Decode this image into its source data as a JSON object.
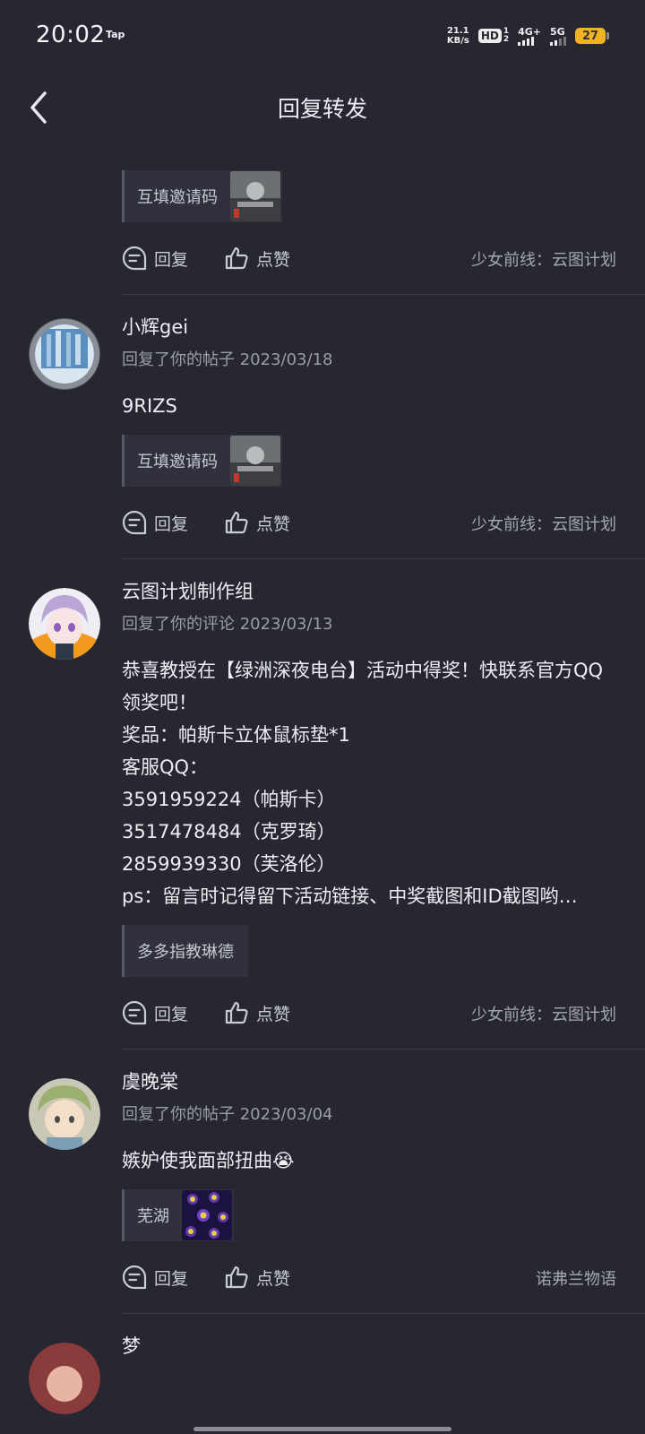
{
  "status": {
    "time": "20:02",
    "tap_label": "Tap",
    "net_speed_value": "21.1",
    "net_speed_unit": "KB/s",
    "hd_label": "HD",
    "hd_sub_top": "1",
    "hd_sub_bottom": "2",
    "net1_label": "4G+",
    "net2_label": "5G",
    "battery": "27"
  },
  "header": {
    "title": "回复转发"
  },
  "actions": {
    "reply_label": "回复",
    "like_label": "点赞"
  },
  "top_partial": {
    "quote_text": "互填邀请码",
    "source": "少女前线：云图计划"
  },
  "items": [
    {
      "name": "小辉gei",
      "meta": "回复了你的帖子 2023/03/18",
      "content": "9RIZS",
      "quote_text": "互填邀请码",
      "source": "少女前线：云图计划"
    },
    {
      "name": "云图计划制作组",
      "meta": "回复了你的评论 2023/03/13",
      "content": "恭喜教授在【绿洲深夜电台】活动中得奖！快联系官方QQ领奖吧！\n奖品：帕斯卡立体鼠标垫*1\n客服QQ：\n3591959224（帕斯卡）\n3517478484（克罗琦）\n2859939330（芙洛伦）\nps：留言时记得留下活动链接、中奖截图和ID截图哟…",
      "quote_text": "多多指教琳德",
      "source": "少女前线：云图计划"
    },
    {
      "name": "虞晚棠",
      "meta": "回复了你的帖子 2023/03/04",
      "content": "嫉妒使我面部扭曲😭",
      "quote_text": "芜湖",
      "source": "诺弗兰物语"
    },
    {
      "name": "梦"
    }
  ]
}
